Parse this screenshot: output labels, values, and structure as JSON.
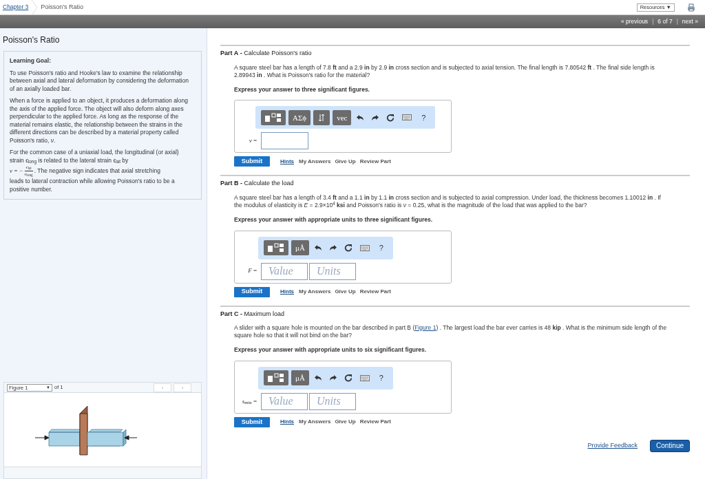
{
  "breadcrumb": {
    "chapter": "Chapter 3",
    "page": "Poisson's Ratio"
  },
  "resources": "Resources ▼",
  "pager": {
    "previous": "« previous",
    "separator_1": "|",
    "position": "6 of 7",
    "separator_2": "|",
    "next": "next »"
  },
  "sidebar": {
    "title": "Poisson's Ratio",
    "goal_heading": "Learning Goal:",
    "paragraphs": [
      "To use Poisson's ratio and Hooke's law to examine the relationship between axial and lateral deformation by considering the deformation of an axially loaded bar.",
      "When a force is applied to an object, it produces a deformation along the axis of the applied force. The object will also deform along axes perpendicular to the applied force. As long as the response of the material remains elastic, the relationship between the strains in the different directions can be described by a material property called Poisson's ratio, *ν*.",
      "For the common case of a uniaxial load, the longitudinal (or axial) strain ϵ$_{long}$ is related to the lateral strain ϵ$_{lat}$ by"
    ],
    "formula": {
      "lhs": "ν = −",
      "numerator": "ϵ$_{lat}$",
      "denominator": "ϵ$_{long}$",
      "after": ". The negative sign indicates that axial stretching"
    },
    "closing": "leads to lateral contraction while allowing Poisson's ratio to be a positive number.",
    "figure": {
      "select": "Figure 1",
      "caret": "▼",
      "count": "of 1",
      "prev": "‹",
      "next": "›"
    }
  },
  "parts": [
    {
      "label": "Part A",
      "dash": "-",
      "title": "Calculate Poisson's ratio",
      "actions": {
        "submit": "Submit",
        "links": [
          "Hints",
          "My Answers",
          "Give Up",
          "Review Part"
        ]
      },
      "problem": "A square steel bar has a length of 7.8 **ft** and a 2.9 **in** by 2.9 **in** cross section and is subjected to axial tension. The final length is 7.80542 **ft** . The final side length is 2.89943 **in** . What is Poisson's ratio for the material?",
      "instruction": "Express your answer to three significant figures.",
      "tools": [
        {
          "kind": "templates"
        },
        {
          "kind": "text",
          "label": "ΑΣϕ"
        },
        {
          "kind": "updown"
        },
        {
          "kind": "text",
          "label": "vec"
        },
        {
          "kind": "undo"
        },
        {
          "kind": "redo"
        },
        {
          "kind": "reset"
        },
        {
          "kind": "keyboard"
        },
        {
          "kind": "help",
          "label": "?"
        }
      ],
      "variable": "*ν* =",
      "input": {
        "kind": "single"
      }
    },
    {
      "label": "Part B",
      "dash": "-",
      "title": "Calculate the load",
      "actions": {
        "submit": "Submit",
        "links": [
          "Hints",
          "My Answers",
          "Give Up",
          "Review Part"
        ]
      },
      "problem": "A square steel bar has a length of 3.4 **ft** and a 1.1 **in** by 1.1 **in** cross section and is subjected to axial compression. Under load, the thickness becomes 1.10012 **in** . If the modulus of elasticity is *E* = 2.9×10$^{4}$ **ksi** and Poisson's ratio is *ν* = 0.25, what is the magnitude of the load that was applied to the bar?",
      "instruction": "Express your answer with appropriate units to three significant figures.",
      "tools": [
        {
          "kind": "templates"
        },
        {
          "kind": "text",
          "label": "μÅ"
        },
        {
          "kind": "undo"
        },
        {
          "kind": "redo"
        },
        {
          "kind": "reset"
        },
        {
          "kind": "keyboard"
        },
        {
          "kind": "help",
          "label": "?"
        }
      ],
      "variable": "*F* =",
      "input": {
        "kind": "value_units",
        "value_placeholder": "Value",
        "units_placeholder": "Units"
      }
    },
    {
      "label": "Part C",
      "dash": "-",
      "title": "Maximum load",
      "actions": {
        "submit": "Submit",
        "links": [
          "Hints",
          "My Answers",
          "Give Up",
          "Review Part"
        ]
      },
      "problem": "A slider with a square hole is mounted on the bar described in part B (",
      "link": "Figure 1",
      "problem_after": ") . The largest load the bar ever carries is 48 **kip** . What is the minimum side length of the square hole so that it will not bind on the bar?",
      "instruction": "Express your answer with appropriate units to six significant figures.",
      "tools": [
        {
          "kind": "templates"
        },
        {
          "kind": "text",
          "label": "μÅ"
        },
        {
          "kind": "undo"
        },
        {
          "kind": "redo"
        },
        {
          "kind": "reset"
        },
        {
          "kind": "keyboard"
        },
        {
          "kind": "help",
          "label": "?"
        }
      ],
      "variable": "*s*$_{min}$ =",
      "input": {
        "kind": "value_units",
        "value_placeholder": "Value",
        "units_placeholder": "Units"
      }
    }
  ],
  "footer": {
    "feedback": "Provide Feedback",
    "continue": "Continue"
  }
}
